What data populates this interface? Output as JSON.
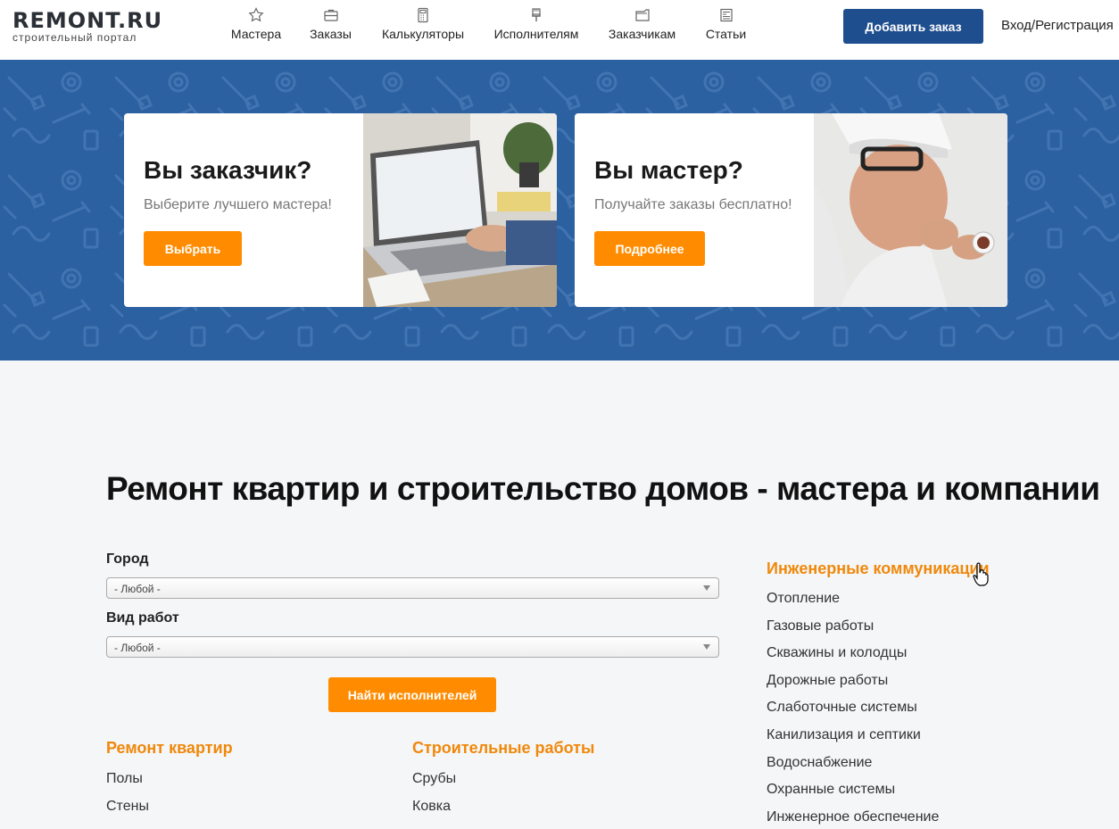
{
  "logo": {
    "title": "REMONT.RU",
    "subtitle": "строительный портал"
  },
  "nav": [
    {
      "label": "Мастера",
      "icon": "star-icon"
    },
    {
      "label": "Заказы",
      "icon": "briefcase-icon"
    },
    {
      "label": "Калькуляторы",
      "icon": "calculator-icon"
    },
    {
      "label": "Исполнителям",
      "icon": "brush-icon"
    },
    {
      "label": "Заказчикам",
      "icon": "folder-icon"
    },
    {
      "label": "Статьи",
      "icon": "newspaper-icon"
    }
  ],
  "header": {
    "add_order": "Добавить заказ",
    "login": "Вход/Регистрация"
  },
  "hero": {
    "customer": {
      "title": "Вы заказчик?",
      "subtitle": "Выберите лучшего мастера!",
      "button": "Выбрать"
    },
    "master": {
      "title": "Вы мастер?",
      "subtitle": "Получайте заказы бесплатно!",
      "button": "Подробнее"
    }
  },
  "main": {
    "title": "Ремонт квартир и строительство домов - мастера и компании",
    "city_label": "Город",
    "city_value": "- Любой -",
    "work_label": "Вид работ",
    "work_value": "- Любой -",
    "find_button": "Найти исполнителей"
  },
  "categories": {
    "repair": {
      "title": "Ремонт квартир",
      "items": [
        "Полы",
        "Стены"
      ]
    },
    "construction": {
      "title": "Строительные работы",
      "items": [
        "Срубы",
        "Ковка"
      ]
    },
    "engineering": {
      "title": "Инженерные коммуникации",
      "items": [
        "Отопление",
        "Газовые работы",
        "Скважины и колодцы",
        "Дорожные работы",
        "Слаботочные системы",
        "Канилизация и септики",
        "Водоснабжение",
        "Охранные системы",
        "Инженерное обеспечение"
      ]
    }
  },
  "colors": {
    "primary": "#1f4e8e",
    "accent": "#ff8c00",
    "hero_bg": "#2b61a1",
    "category": "#f0880a"
  }
}
